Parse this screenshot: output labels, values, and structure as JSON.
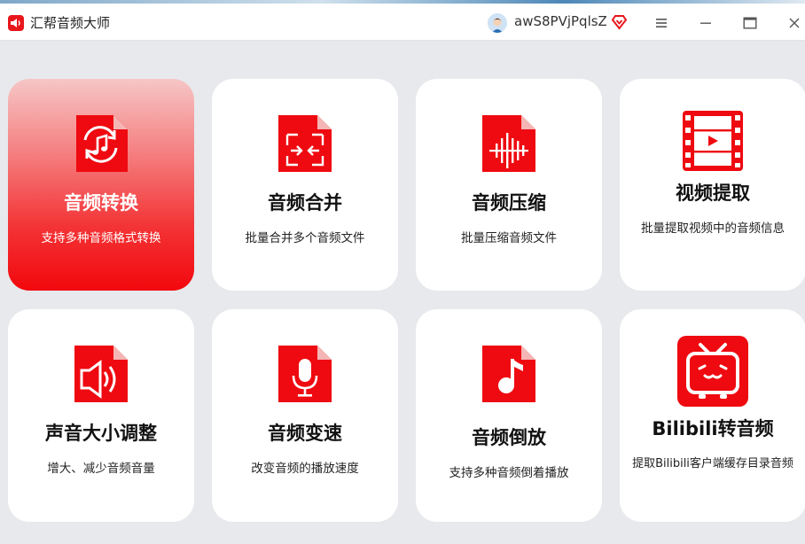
{
  "app": {
    "title": "汇帮音频大师"
  },
  "user": {
    "name": "awS8PVjPqlsZ"
  },
  "colors": {
    "accent": "#f2080d",
    "card_bg": "#ffffff",
    "page_bg": "#e8e9ec"
  },
  "cards": [
    {
      "title": "音频转换",
      "desc": "支持多种音频格式转换",
      "icon": "audio-convert-icon",
      "active": true
    },
    {
      "title": "音频合并",
      "desc": "批量合并多个音频文件",
      "icon": "audio-merge-icon"
    },
    {
      "title": "音频压缩",
      "desc": "批量压缩音频文件",
      "icon": "audio-compress-icon"
    },
    {
      "title": "视频提取",
      "desc": "批量提取视频中的音频信息",
      "icon": "video-extract-icon"
    },
    {
      "title": "声音大小调整",
      "desc": "增大、减少音频音量",
      "icon": "volume-adjust-icon"
    },
    {
      "title": "音频变速",
      "desc": "改变音频的播放速度",
      "icon": "audio-speed-icon"
    },
    {
      "title": "音频倒放",
      "desc": "支持多种音频倒着播放",
      "icon": "audio-reverse-icon"
    },
    {
      "title": "Bilibili转音频",
      "desc": "提取Bilibili客户端缓存目录音频",
      "icon": "bilibili-icon"
    }
  ]
}
